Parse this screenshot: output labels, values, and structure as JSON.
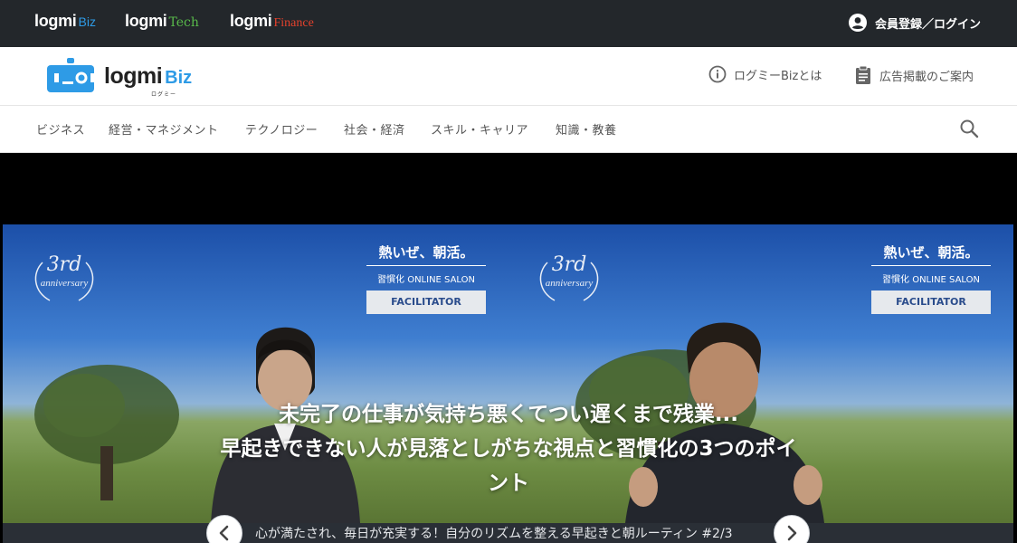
{
  "network": {
    "brands": [
      {
        "name": "logmi",
        "suffix": "Biz"
      },
      {
        "name": "logmi",
        "suffix": "Tech"
      },
      {
        "name": "logmi",
        "suffix": "Finance"
      }
    ],
    "login_label": "会員登録／ログイン"
  },
  "header": {
    "logo_word": "logmi",
    "logo_suffix": "Biz",
    "logo_kana": "ログミー",
    "about_label": "ログミーBizとは",
    "ads_label": "広告掲載のご案内"
  },
  "categories": [
    "ビジネス",
    "経営・マネジメント",
    "テクノロジー",
    "社会・経済",
    "スキル・キャリア",
    "知識・教養"
  ],
  "hero": {
    "anniversary_num": "3rd",
    "anniversary_text": "anniversary",
    "salon_title": "熱いぜ、朝活。",
    "salon_sub": "習慣化 ONLINE SALON",
    "salon_role": "FACILITATOR",
    "title_line1": "未完了の仕事が気持ち悪くてつい遅くまで残業...",
    "title_line2": "早起きできない人が見落としがちな視点と習慣化の3つのポイ",
    "title_line3": "ント",
    "series_text": "心が満たされ、毎日が充実する！自分のリズムを整える早起きと朝ルーティン #2/3"
  },
  "colors": {
    "topbar": "#23272b",
    "biz_blue": "#2e9be6",
    "tech_green": "#58b94a",
    "finance_red": "#e2412c"
  },
  "icons": [
    "account-circle-icon",
    "info-icon",
    "clipboard-icon",
    "search-icon",
    "chevron-left-icon",
    "chevron-right-icon",
    "robot-logo-icon"
  ]
}
